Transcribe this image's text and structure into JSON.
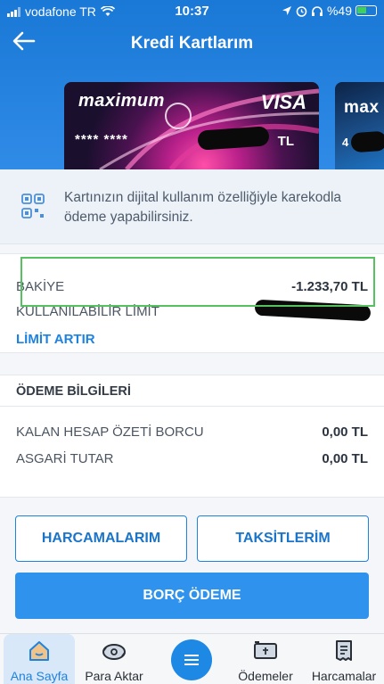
{
  "status_bar": {
    "carrier": "vodafone TR",
    "time": "10:37",
    "battery": "%49"
  },
  "header": {
    "back_icon": "arrow-left-icon",
    "title": "Kredi Kartlarım"
  },
  "cards": [
    {
      "brand": "maximum",
      "network": "VISA",
      "number": "**** ****",
      "currency": "TL"
    },
    {
      "brand": "max",
      "number": "4"
    }
  ],
  "qr_notice": {
    "icon": "qr-code-icon",
    "text": "Kartınızın dijital kullanım özelliğiyle karekodla ödeme yapabilirsiniz."
  },
  "balance": {
    "balance_label": "BAKİYE",
    "balance_value": "-1.233,70 TL",
    "available_label": "KULLANILABİLİR LİMİT",
    "increase_limit_link": "LİMİT ARTIR"
  },
  "payment_info": {
    "section_title": "ÖDEME BİLGİLERİ",
    "rows": [
      {
        "label": "KALAN HESAP ÖZETİ BORCU",
        "value": "0,00 TL"
      },
      {
        "label": "ASGARİ TUTAR",
        "value": "0,00 TL"
      }
    ]
  },
  "actions": {
    "expenses_button": "HARCAMALARIM",
    "installments_button": "TAKSİTLERİM",
    "pay_debt_button": "BORÇ ÖDEME"
  },
  "bottom_nav": {
    "items": [
      {
        "label": "Ana Sayfa",
        "icon": "home-icon",
        "active": true
      },
      {
        "label": "Para Aktar",
        "icon": "money-transfer-icon",
        "active": false
      },
      {
        "label": "",
        "icon": "menu-icon",
        "active": false
      },
      {
        "label": "Ödemeler",
        "icon": "payments-icon",
        "active": false
      },
      {
        "label": "Harcamalar",
        "icon": "receipt-icon",
        "active": false
      }
    ]
  },
  "colors": {
    "primary": "#1e82e0",
    "header": "#1a78d6",
    "highlight_box": "#55c15f"
  }
}
